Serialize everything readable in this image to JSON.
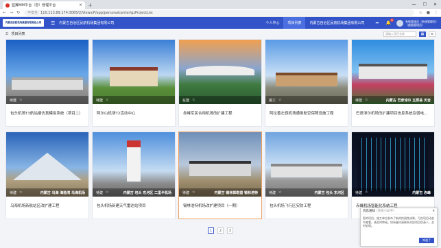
{
  "browser": {
    "tab_title": "蓝翼BIM平台（您）管理平台",
    "url": "110.113.89.174:3085/2/Views/P/app/personalcenter/gzProjectList",
    "security": "不安全"
  },
  "app": {
    "logo_text": "内蒙古民航机场集团有限责任公司",
    "org_selector": "内蒙古自治区民航机场集团有限公司",
    "nav": [
      "个人中心",
      "项目列表",
      "内蒙古自治区民航机场集团有限公司"
    ],
    "notification_count": "5",
    "user_name": "系统管理员（系统管理员）",
    "user_role": "（超级管理员）"
  },
  "list": {
    "title": "项目列表",
    "search_placeholder": "请输入项目名称"
  },
  "projects": [
    {
      "status": "待建",
      "caption": "",
      "name": "包头机场T3航站楼仿真模拟系统（项目二）"
    },
    {
      "status": "待建",
      "caption": "",
      "name": "阿尔山机场T2活动中心"
    },
    {
      "status": "在建",
      "caption": "",
      "name": "赤峰军民合用机场改扩建工程"
    },
    {
      "status": "竣工",
      "caption": "",
      "name": "阿拉善左旗机场通用航空保障设施工程"
    },
    {
      "status": "待建",
      "caption": "内蒙古 巴彦淖尔 五原县 天吉",
      "name": "巴彦淖尔机场改扩建项目信息系统及弱电工程"
    },
    {
      "status": "待建",
      "caption": "内蒙古 乌海 海勃湾 乌海机场",
      "name": "乌海机场新航站区改扩建工程"
    },
    {
      "status": "待建",
      "caption": "内蒙古 包头 东河区 二里半机场",
      "name": "包头机场新建天气雷达站项目"
    },
    {
      "status": "待建",
      "caption": "内蒙古 锡林郭勒盟 锡林浩特",
      "name": "锡林浩特机场改扩建项目（一期）"
    },
    {
      "status": "待建",
      "caption": "内蒙古 包头 东河区",
      "name": "包头机场飞行区安防工程"
    },
    {
      "status": "待建",
      "caption": "内蒙古 赤峰",
      "name": "赤峰机场智能化系统工程"
    }
  ],
  "pagination": [
    "1",
    "2",
    "3"
  ],
  "notice": {
    "title": "消息通知",
    "subtitle": "(系统小助手)",
    "body": "您的项目，施工单位发布了新的阶段性成果，可在项目动态中查看，请及时审阅。如有疑问请联系对应项目负责人，及时处理。",
    "button": "知道了"
  }
}
